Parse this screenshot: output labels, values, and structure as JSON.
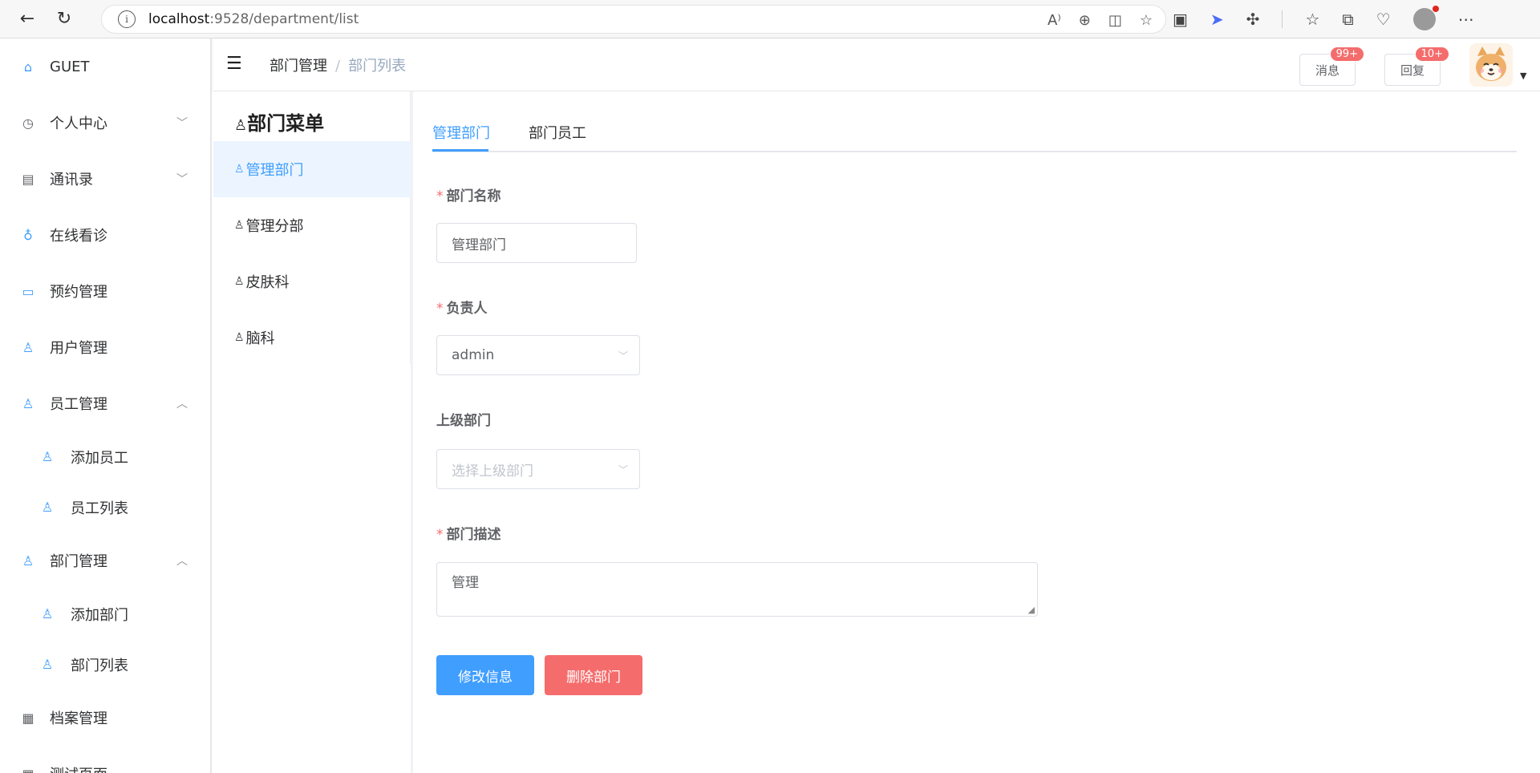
{
  "browser": {
    "url_host": "localhost",
    "url_rest": ":9528/department/list"
  },
  "sidebar": {
    "items": [
      {
        "label": "GUET",
        "icon": "home-icon",
        "arrow": ""
      },
      {
        "label": "个人中心",
        "icon": "clock-icon",
        "arrow": "⌄"
      },
      {
        "label": "通讯录",
        "icon": "contacts-icon",
        "arrow": "⌄"
      },
      {
        "label": "在线看诊",
        "icon": "stethoscope-icon",
        "arrow": ""
      },
      {
        "label": "预约管理",
        "icon": "briefcase-icon",
        "arrow": ""
      },
      {
        "label": "用户管理",
        "icon": "user-icon",
        "arrow": ""
      },
      {
        "label": "员工管理",
        "icon": "user-icon",
        "arrow": "⌃"
      },
      {
        "label": "添加员工",
        "icon": "user-icon",
        "arrow": ""
      },
      {
        "label": "员工列表",
        "icon": "user-icon",
        "arrow": ""
      },
      {
        "label": "部门管理",
        "icon": "user-icon",
        "arrow": "⌃"
      },
      {
        "label": "添加部门",
        "icon": "user-icon",
        "arrow": ""
      },
      {
        "label": "部门列表",
        "icon": "user-icon",
        "arrow": ""
      },
      {
        "label": "档案管理",
        "icon": "document-icon",
        "arrow": ""
      },
      {
        "label": "测试页面",
        "icon": "document-icon",
        "arrow": ""
      }
    ]
  },
  "header": {
    "breadcrumb": [
      "部门管理",
      "部门列表"
    ],
    "messages_label": "消息",
    "messages_badge": "99+",
    "reply_label": "回复",
    "reply_badge": "10+"
  },
  "dept_menu": {
    "title": "部门菜单",
    "items": [
      "管理部门",
      "管理分部",
      "皮肤科",
      "脑科"
    ],
    "active_index": 0
  },
  "tabs": [
    "管理部门",
    "部门员工"
  ],
  "form": {
    "name_label": "部门名称",
    "name_value": "管理部门",
    "leader_label": "负责人",
    "leader_value": "admin",
    "parent_label": "上级部门",
    "parent_placeholder": "选择上级部门",
    "desc_label": "部门描述",
    "desc_value": "管理",
    "update_button": "修改信息",
    "delete_button": "删除部门"
  },
  "colors": {
    "primary": "#409eff",
    "danger": "#f56c6c",
    "active_bg": "#ecf5ff"
  }
}
